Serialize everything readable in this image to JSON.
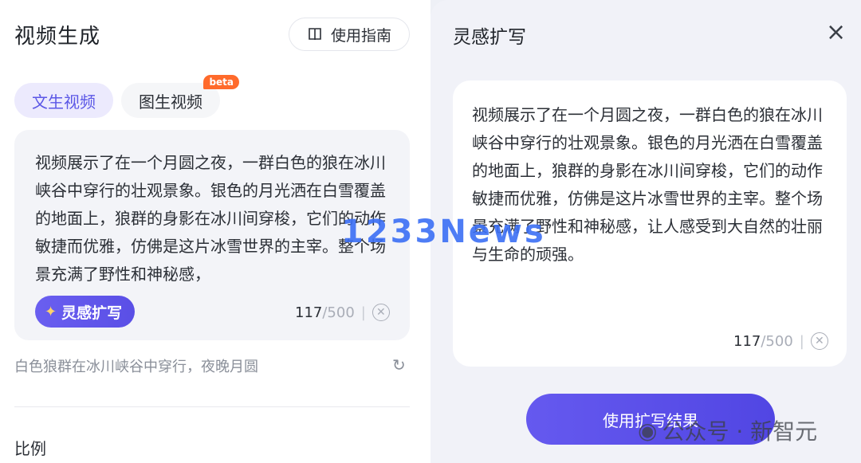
{
  "left": {
    "title": "视频生成",
    "guide_label": "使用指南",
    "tabs": [
      {
        "label": "文生视频",
        "active": true
      },
      {
        "label": "图生视频",
        "active": false,
        "badge": "beta"
      }
    ],
    "prompt": {
      "text": "视频展示了在一个月圆之夜，一群白色的狼在冰川峡谷中穿行的壮观景象。银色的月光洒在白雪覆盖的地面上，狼群的身影在冰川间穿梭，它们的动作敏捷而优雅，仿佛是这片冰雪世界的主宰。整个场景充满了野性和神秘感，",
      "inspire_label": "灵感扩写",
      "count": "117",
      "max": "/500",
      "sep": "|"
    },
    "suggestion": "白色狼群在冰川峡谷中穿行，夜晚月圆",
    "ratio_label": "比例"
  },
  "right": {
    "title": "灵感扩写",
    "result_text": "视频展示了在一个月圆之夜，一群白色的狼在冰川峡谷中穿行的壮观景象。银色的月光洒在白雪覆盖的地面上，狼群的身影在冰川间穿梭，它们的动作敏捷而优雅，仿佛是这片冰雪世界的主宰。整个场景充满了野性和神秘感，让人感受到大自然的壮丽与生命的顽强。",
    "count": "117",
    "max": "/500",
    "sep": "|",
    "use_label": "使用扩写结果"
  },
  "watermarks": {
    "center": "1233News",
    "corner": "公众号 · 新智元"
  },
  "colors": {
    "accent": "#5b57e6",
    "beta": "#ff6a2b"
  }
}
